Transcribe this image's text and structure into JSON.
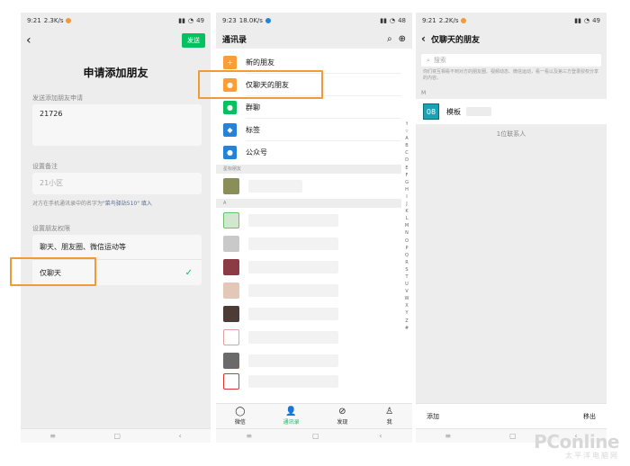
{
  "panel1": {
    "status": {
      "time": "9:21",
      "speed": "2.3K/s",
      "battery": "49"
    },
    "send_label": "发送",
    "title": "申请添加朋友",
    "request_label": "发送添加朋友申请",
    "request_value": "21726",
    "remark_label": "设置备注",
    "remark_value": "21小区",
    "hint_prefix": "对方在手机通讯录中的名字为",
    "hint_name": "\"菜鸟驿站510\"",
    "hint_action": "填入",
    "permission_label": "设置朋友权限",
    "option_full": "聊天、朋友圈、微信运动等",
    "option_chat_only": "仅聊天"
  },
  "panel2": {
    "status": {
      "time": "9:23",
      "speed": "18.0K/s",
      "battery": "48"
    },
    "title": "通讯录",
    "rows": [
      {
        "label": "新的朋友",
        "color": "#fa9d3b"
      },
      {
        "label": "仅聊天的朋友",
        "color": "#fa9d3b"
      },
      {
        "label": "群聊",
        "color": "#07c160"
      },
      {
        "label": "标签",
        "color": "#2782d7"
      },
      {
        "label": "公众号",
        "color": "#2782d7"
      }
    ],
    "starred_label": "星标朋友",
    "group_a": "A",
    "alphabet": [
      "↑",
      "☆",
      "A",
      "B",
      "C",
      "D",
      "E",
      "F",
      "G",
      "H",
      "I",
      "J",
      "K",
      "L",
      "M",
      "N",
      "O",
      "P",
      "Q",
      "R",
      "S",
      "T",
      "U",
      "V",
      "W",
      "X",
      "Y",
      "Z",
      "#"
    ],
    "tabs": [
      {
        "label": "微信",
        "icon": "chat-icon"
      },
      {
        "label": "通讯录",
        "icon": "contacts-icon"
      },
      {
        "label": "发现",
        "icon": "compass-icon"
      },
      {
        "label": "我",
        "icon": "person-icon"
      }
    ]
  },
  "panel3": {
    "status": {
      "time": "9:21",
      "speed": "2.2K/s",
      "battery": "49"
    },
    "title": "仅聊天的朋友",
    "search_placeholder": "搜索",
    "description": "你们将互相看不到对方的朋友圈、视频动态、微信运动，看一看以及第三方登录授权分享的内容。",
    "letter": "M",
    "contact_avatar": "08",
    "contact_name": "模板",
    "count": "1位联系人",
    "add_label": "添加",
    "remove_label": "移出"
  },
  "watermark": {
    "main": "PConline",
    "sub": "太平洋电脑网"
  },
  "colors": {
    "wechat_green": "#07c160",
    "highlight": "#f29a37",
    "orange_icon": "#fa9d3b",
    "blue_icon": "#2782d7"
  }
}
